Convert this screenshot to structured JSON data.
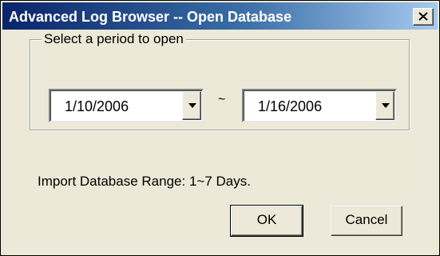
{
  "window": {
    "title": "Advanced Log Browser -- Open Database"
  },
  "period_group": {
    "legend": "Select a period to open",
    "start_date": "1/10/2006",
    "separator": "~",
    "end_date": "1/16/2006"
  },
  "range_note": "Import Database Range: 1~7 Days.",
  "buttons": {
    "ok_label": "OK",
    "cancel_label": "Cancel"
  },
  "icons": {
    "close": "close-icon",
    "dropdown": "chevron-down-icon"
  },
  "colors": {
    "titlebar_start": "#0a246a",
    "titlebar_end": "#a6caf0",
    "dialog_background": "#ece9d8"
  }
}
